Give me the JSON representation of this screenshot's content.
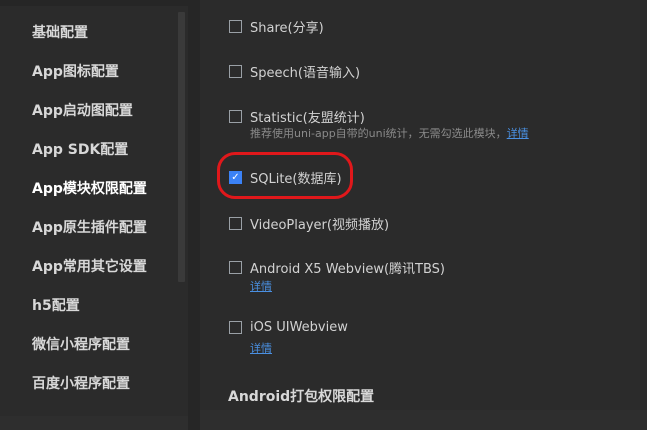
{
  "sidebar": {
    "items": [
      {
        "label": "基础配置"
      },
      {
        "label": "App图标配置"
      },
      {
        "label": "App启动图配置"
      },
      {
        "label": "App SDK配置"
      },
      {
        "label": "App模块权限配置"
      },
      {
        "label": "App原生插件配置"
      },
      {
        "label": "App常用其它设置"
      },
      {
        "label": "h5配置"
      },
      {
        "label": "微信小程序配置"
      },
      {
        "label": "百度小程序配置"
      }
    ],
    "active_index": 4
  },
  "modules": {
    "share": {
      "label": "Share(分享)",
      "checked": false
    },
    "speech": {
      "label": "Speech(语音输入)",
      "checked": false
    },
    "statistic": {
      "label": "Statistic(友盟统计)",
      "checked": false,
      "hint": "推荐使用uni-app自带的uni统计，无需勾选此模块，",
      "link": "详情"
    },
    "sqlite": {
      "label": "SQLite(数据库)",
      "checked": true
    },
    "videoplayer": {
      "label": "VideoPlayer(视频播放)",
      "checked": false
    },
    "x5webview": {
      "label": "Android X5 Webview(腾讯TBS)",
      "checked": false,
      "link": "详情"
    },
    "uiwebview": {
      "label": "iOS UIWebview",
      "checked": false,
      "link": "详情"
    }
  },
  "section_title": "Android打包权限配置",
  "colors": {
    "background": "#2b2b2b",
    "accent": "#3b82f6",
    "link": "#4a90e2",
    "highlight": "#e0181b"
  }
}
